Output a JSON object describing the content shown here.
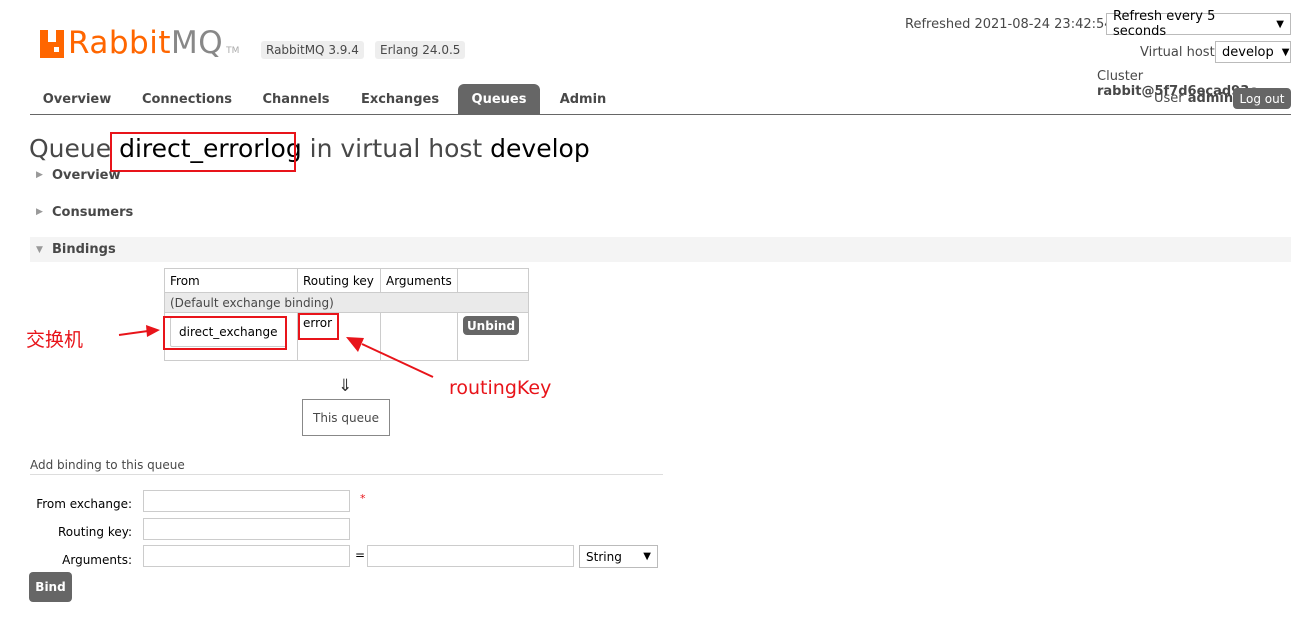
{
  "brand": {
    "name_a": "Rabbit",
    "name_b": "MQ",
    "tm": "TM"
  },
  "versions": {
    "rabbitmq": "RabbitMQ 3.9.4",
    "erlang": "Erlang 24.0.5"
  },
  "header": {
    "refreshed_label": "Refreshed 2021-08-24 23:42:54",
    "refresh_select": "Refresh every 5 seconds",
    "vhost_label": "Virtual host",
    "vhost_select": "develop",
    "cluster_label": "Cluster",
    "cluster_value": "rabbit@5f7d6ecad93c",
    "user_label": "User",
    "user_value": "admin",
    "logout": "Log out"
  },
  "tabs": [
    {
      "label": "Overview"
    },
    {
      "label": "Connections"
    },
    {
      "label": "Channels"
    },
    {
      "label": "Exchanges"
    },
    {
      "label": "Queues"
    },
    {
      "label": "Admin"
    }
  ],
  "page_title": {
    "prefix": "Queue ",
    "queue_name": "direct_errorlog",
    "middle": " in virtual host ",
    "vhost": "develop"
  },
  "sections": {
    "overview": "Overview",
    "consumers": "Consumers",
    "bindings": "Bindings"
  },
  "bindings_table": {
    "headers": [
      "From",
      "Routing key",
      "Arguments",
      ""
    ],
    "default_row": "(Default exchange binding)",
    "row": {
      "from": "direct_exchange",
      "routing_key": "error",
      "arguments": "",
      "action": "Unbind"
    }
  },
  "flow": {
    "arrow": "⇓",
    "this_queue": "This queue"
  },
  "annotations": {
    "exchange": "交换机",
    "routing_key": "routingKey"
  },
  "add_binding": {
    "heading": "Add binding to this queue",
    "from_exchange_label": "From exchange:",
    "routing_key_label": "Routing key:",
    "arguments_label": "Arguments:",
    "required_mark": "*",
    "equals": "=",
    "type_select": "String",
    "bind_button": "Bind"
  },
  "colors": {
    "brand_orange": "#ff6600",
    "annotation_red": "#e8141a",
    "tab_active": "#666666"
  }
}
